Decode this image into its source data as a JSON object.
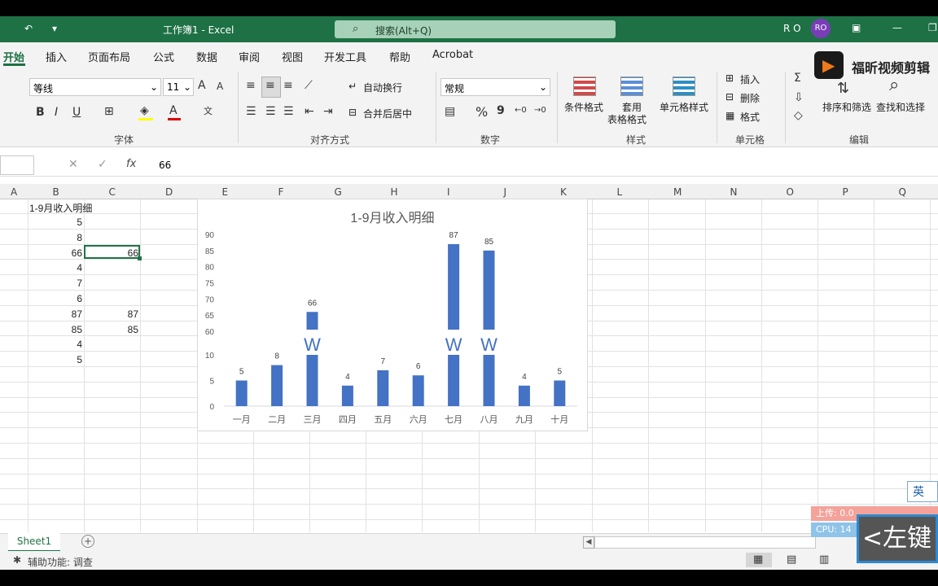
{
  "window": {
    "title": "工作簿1 - Excel",
    "user_initials": "R O",
    "avatar": "RO"
  },
  "search": {
    "placeholder": "搜索(Alt+Q)"
  },
  "tabs": [
    "开始",
    "插入",
    "页面布局",
    "公式",
    "数据",
    "审阅",
    "视图",
    "开发工具",
    "帮助",
    "Acrobat"
  ],
  "ribbon": {
    "font_name": "等线",
    "font_size": "11",
    "grow_font": "A",
    "shrink_font": "A",
    "bold": "B",
    "italic": "I",
    "underline": "U",
    "wrap_text": "自动换行",
    "merge_center": "合并后居中",
    "number_format": "常规",
    "percent": "%",
    "comma": "9",
    "cond_format": "条件格式",
    "table_format_1": "套用",
    "table_format_2": "表格格式",
    "cell_styles": "单元格样式",
    "insert": "插入",
    "delete": "删除",
    "format": "格式",
    "sort_filter": "排序和筛选",
    "find_select": "查找和选择",
    "group_font": "字体",
    "group_align": "对齐方式",
    "group_number": "数字",
    "group_styles": "样式",
    "group_cells": "单元格",
    "group_edit": "编辑",
    "promo": "福昕视频剪辑"
  },
  "formula_bar": {
    "fx": "fx",
    "value": "66"
  },
  "columns": [
    "A",
    "B",
    "C",
    "D",
    "E",
    "F",
    "G",
    "H",
    "I",
    "J",
    "K",
    "L",
    "M",
    "N",
    "O",
    "P",
    "Q"
  ],
  "cells": {
    "b1": "1-9月收入明细",
    "col_b": [
      "5",
      "8",
      "66",
      "4",
      "7",
      "6",
      "87",
      "85",
      "4",
      "5"
    ],
    "col_c": [
      "",
      "",
      "66",
      "",
      "",
      "",
      "87",
      "85",
      "",
      ""
    ]
  },
  "chart_data": {
    "type": "bar",
    "title": "1-9月收入明细",
    "categories": [
      "一月",
      "二月",
      "三月",
      "四月",
      "五月",
      "六月",
      "七月",
      "八月",
      "九月",
      "十月"
    ],
    "values": [
      5,
      8,
      66,
      4,
      7,
      6,
      87,
      85,
      4,
      5
    ],
    "y_ticks_lower": [
      0,
      5,
      10
    ],
    "y_ticks_upper": [
      60,
      65,
      70,
      75,
      80,
      85,
      90
    ],
    "axis_break": true,
    "break_symbol": "W",
    "bar_color": "#4472c4"
  },
  "sheet": {
    "tab": "Sheet1",
    "add": "+"
  },
  "status": {
    "accessibility": "辅助功能: 调查"
  },
  "overlay": {
    "ime": "英",
    "upload": "上传: 0.0",
    "cpu": "CPU: 14",
    "shortcut": "<左键"
  }
}
